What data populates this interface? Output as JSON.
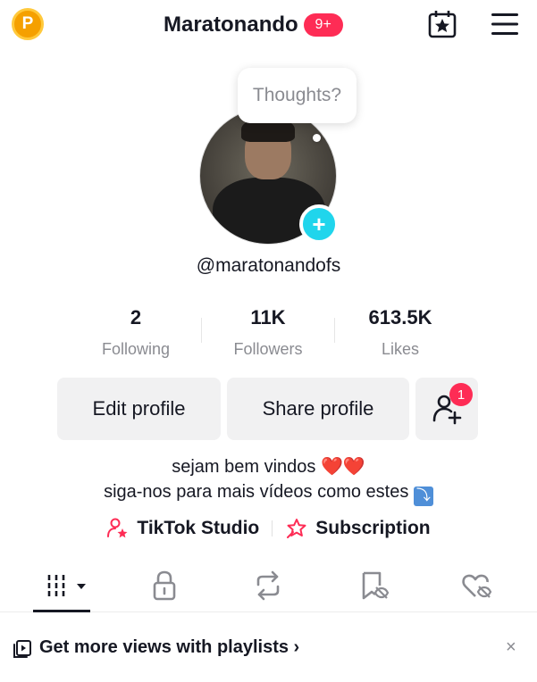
{
  "header": {
    "coin_label": "P",
    "title": "Maratonando",
    "notification_badge": "9+"
  },
  "profile": {
    "bubble_text": "Thoughts?",
    "add_symbol": "+",
    "username": "@maratonandofs"
  },
  "stats": [
    {
      "value": "2",
      "label": "Following"
    },
    {
      "value": "11K",
      "label": "Followers"
    },
    {
      "value": "613.5K",
      "label": "Likes"
    }
  ],
  "buttons": {
    "edit_profile": "Edit profile",
    "share_profile": "Share profile",
    "add_friends_badge": "1"
  },
  "bio": {
    "line1_text": "sejam bem vindos ",
    "line1_emoji": "❤️❤️",
    "line2_text": "siga-nos para mais vídeos como estes ",
    "line2_emoji": "⤵"
  },
  "links": {
    "studio": "TikTok Studio",
    "subscription": "Subscription"
  },
  "tabs": [
    "videos-tab",
    "private-tab",
    "reposts-tab",
    "favorites-tab",
    "liked-tab"
  ],
  "banner": {
    "text": "Get more views with playlists",
    "chevron": "›",
    "close": "×"
  },
  "colors": {
    "accent": "#fe2c55",
    "add_button": "#20d5ec",
    "coin": "#f5a000",
    "muted": "#8a8b91",
    "button_bg": "#f1f1f2"
  }
}
